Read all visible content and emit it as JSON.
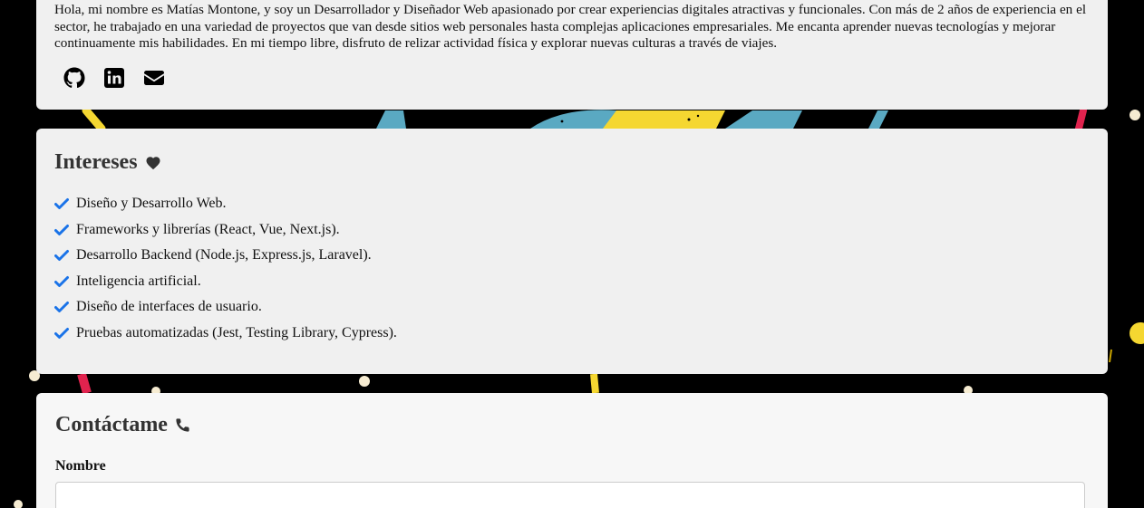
{
  "about": {
    "text": "Hola, mi nombre es Matías Montone, y soy un Desarrollador y Diseñador Web apasionado por crear experiencias digitales atractivas y funcionales. Con más de 2 años de experiencia en el sector, he trabajado en una variedad de proyectos que van desde sitios web personales hasta complejas aplicaciones empresariales. Me encanta aprender nuevas tecnologías y mejorar continuamente mis habilidades. En mi tiempo libre, disfruto de relizar actividad física y explorar nuevas culturas a través de viajes.",
    "social": [
      {
        "icon": "github-icon"
      },
      {
        "icon": "linkedin-icon"
      },
      {
        "icon": "envelope-icon"
      }
    ]
  },
  "interests": {
    "title": "Intereses",
    "title_icon": "heart-icon",
    "items": [
      "Diseño y Desarrollo Web.",
      "Frameworks y librerías (React, Vue, Next.js).",
      "Desarrollo Backend (Node.js, Express.js, Laravel).",
      "Inteligencia artificial.",
      "Diseño de interfaces de usuario.",
      "Pruebas automatizadas (Jest, Testing Library, Cypress)."
    ]
  },
  "contact": {
    "title": "Contáctame",
    "title_icon": "phone-icon",
    "name_label": "Nombre",
    "name_value": ""
  },
  "colors": {
    "page_background": "#000000",
    "card_background": "#f0f0f0",
    "check_blue": "#1a73e8",
    "accent_yellow": "#f5d731",
    "accent_blue": "#5aa9c2",
    "accent_red": "#e0234e"
  }
}
